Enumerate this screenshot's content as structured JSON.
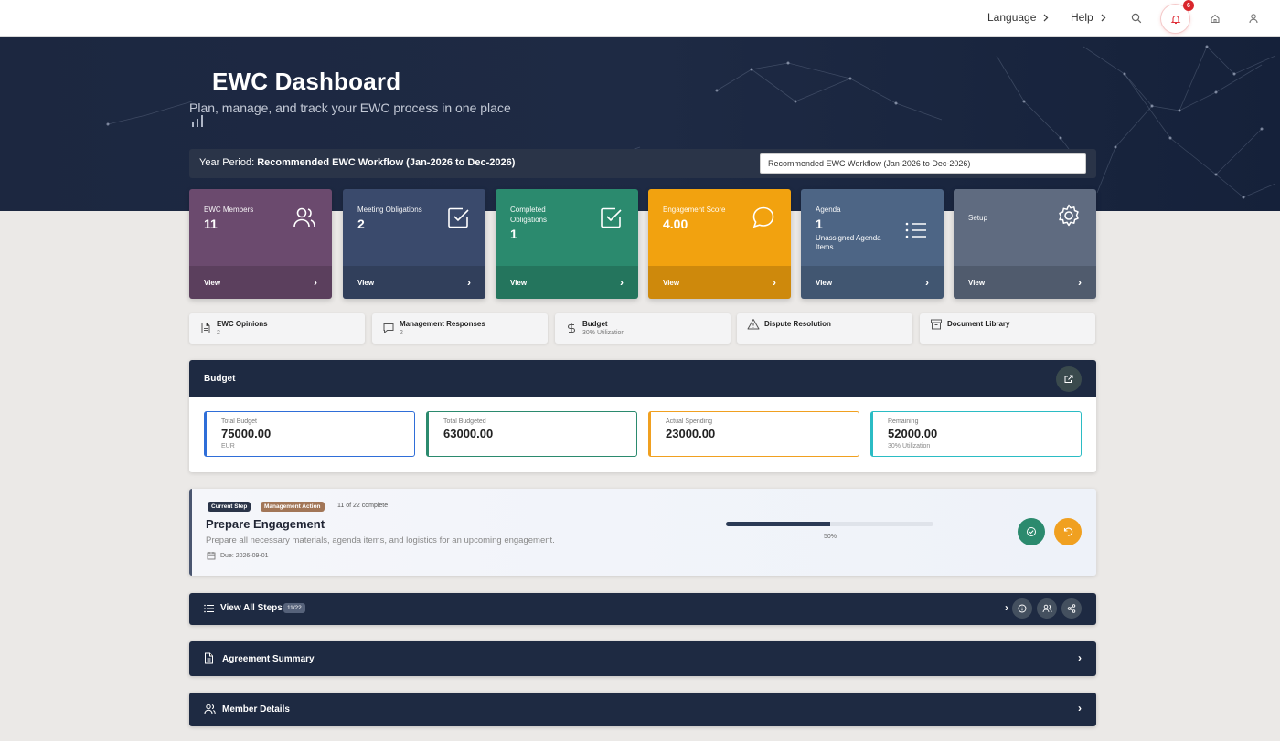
{
  "topnav": {
    "language": "Language",
    "help": "Help",
    "notification_count": "6",
    "icons": [
      "search-icon",
      "bell-icon",
      "home-icon",
      "user-icon"
    ]
  },
  "hero": {
    "title": "EWC Dashboard",
    "subtitle": "Plan, manage, and track your EWC process in one place"
  },
  "year_period": {
    "label": "Year Period:",
    "value": "Recommended EWC Workflow (Jan-2026 to Dec-2026)",
    "selected": "Recommended EWC Workflow (Jan-2026 to Dec-2026)"
  },
  "stat_cards": [
    {
      "label": "EWC Members",
      "value": "11",
      "sub": "",
      "view": "View",
      "color": "#6b4a6e",
      "icon": "users-icon"
    },
    {
      "label": "Meeting Obligations",
      "value": "2",
      "sub": "",
      "view": "View",
      "color": "#3a4a6c",
      "icon": "check-square-icon"
    },
    {
      "label": "Completed Obligations",
      "value": "1",
      "sub": "",
      "view": "View",
      "color": "#2b8a6e",
      "icon": "check-square-icon"
    },
    {
      "label": "Engagement Score",
      "value": "4.00",
      "sub": "",
      "view": "View",
      "color": "#f2a20f",
      "icon": "chat-bubble-icon"
    },
    {
      "label": "Agenda",
      "value": "1",
      "sub": "Unassigned Agenda Items",
      "view": "View",
      "color": "#4d6585",
      "icon": "list-icon"
    },
    {
      "label": "Setup",
      "value": "",
      "sub": "",
      "view": "View",
      "color": "#5f6b80",
      "icon": "gear-icon"
    }
  ],
  "quick_links": [
    {
      "title": "EWC Opinions",
      "sub": "2",
      "icon": "document-icon"
    },
    {
      "title": "Management Responses",
      "sub": "2",
      "icon": "message-icon"
    },
    {
      "title": "Budget",
      "sub": "30% Utilization",
      "icon": "dollar-icon"
    },
    {
      "title": "Dispute Resolution",
      "sub": "",
      "icon": "warning-icon"
    },
    {
      "title": "Document Library",
      "sub": "",
      "icon": "archive-icon"
    }
  ],
  "budget": {
    "title": "Budget",
    "cards": [
      {
        "label": "Total Budget",
        "value": "75000.00",
        "sub": "EUR",
        "color": "#2f6ed8"
      },
      {
        "label": "Total Budgeted",
        "value": "63000.00",
        "sub": "",
        "color": "#2b8a6e"
      },
      {
        "label": "Actual Spending",
        "value": "23000.00",
        "sub": "",
        "color": "#f0a020"
      },
      {
        "label": "Remaining",
        "value": "52000.00",
        "sub": "30% Utilization",
        "color": "#2bbcc4"
      }
    ]
  },
  "current_step": {
    "badge_step": "Current Step",
    "badge_action": "Management Action",
    "count": "11 of 22 complete",
    "name": "Prepare Engagement",
    "description": "Prepare all necessary materials, agenda items, and logistics for an upcoming engagement.",
    "due": "Due: 2026-09-01",
    "progress": 0.5,
    "progress_text": "50%"
  },
  "accordions": {
    "steps": {
      "title": "View All Steps",
      "pill": "11/22"
    },
    "agreement": {
      "title": "Agreement Summary"
    },
    "members": {
      "title": "Member Details"
    }
  }
}
